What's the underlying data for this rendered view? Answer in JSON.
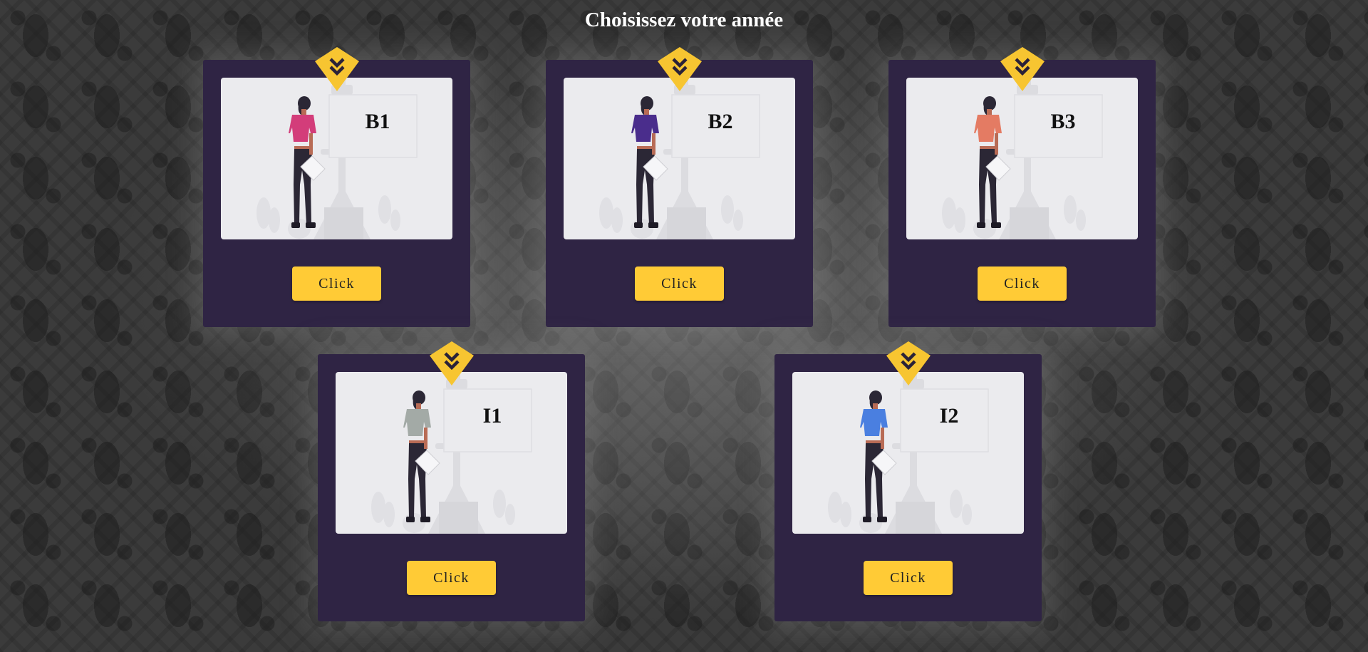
{
  "page": {
    "title": "Choisissez votre année"
  },
  "colors": {
    "card_background": "#2f2444",
    "button": "#ffcb36",
    "badge": "#f7c531",
    "image_background": "#ebebee"
  },
  "cards": [
    {
      "label": "B1",
      "button_label": "Click",
      "shirt_color": "#d33d7a",
      "badge_icon": "double-chevron-down-icon"
    },
    {
      "label": "B2",
      "button_label": "Click",
      "shirt_color": "#4a2d8c",
      "badge_icon": "double-chevron-down-icon"
    },
    {
      "label": "B3",
      "button_label": "Click",
      "shirt_color": "#e47b63",
      "badge_icon": "double-chevron-down-icon"
    },
    {
      "label": "I1",
      "button_label": "Click",
      "shirt_color": "#a3aaa6",
      "badge_icon": "double-chevron-down-icon"
    },
    {
      "label": "I2",
      "button_label": "Click",
      "shirt_color": "#4a7fe0",
      "badge_icon": "double-chevron-down-icon"
    }
  ]
}
